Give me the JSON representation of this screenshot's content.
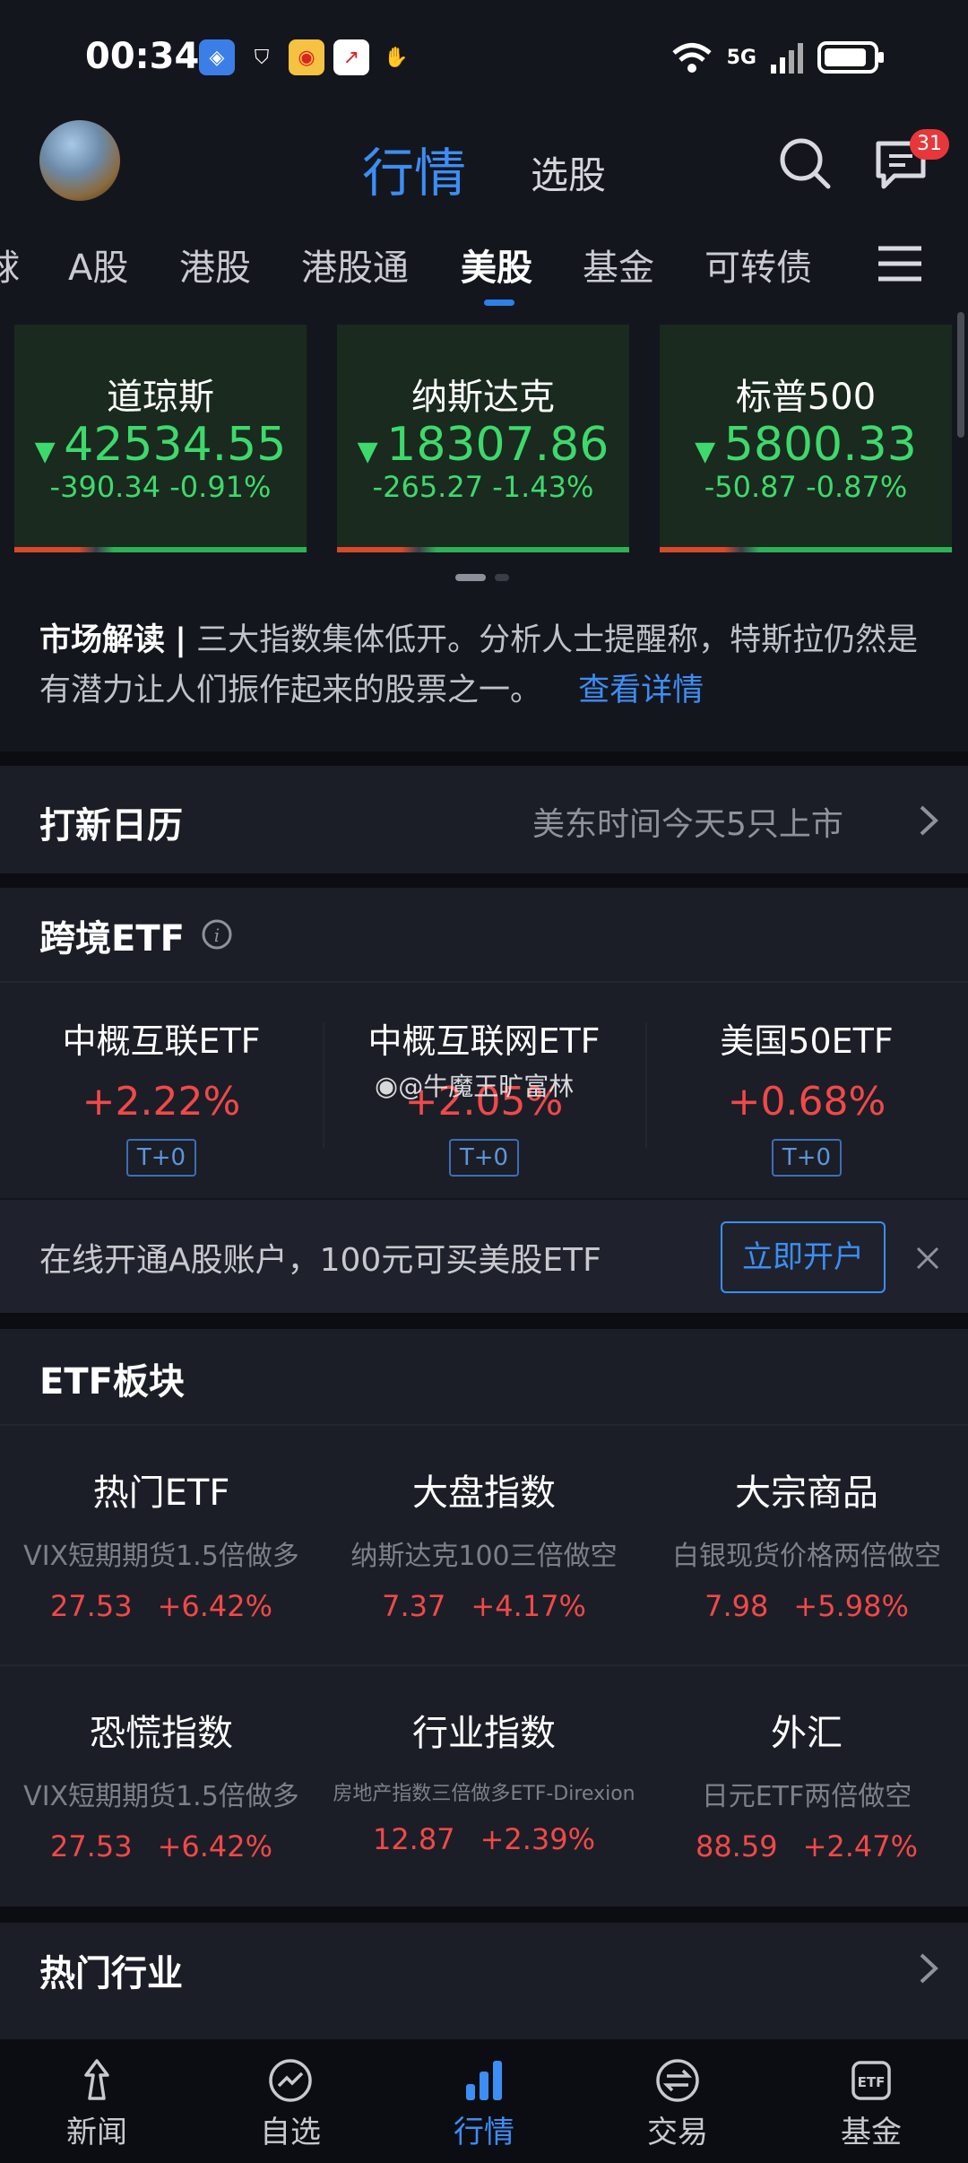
{
  "status_bar": {
    "time": "00:34",
    "network": "5G"
  },
  "header": {
    "title": "行情",
    "subtitle": "选股",
    "message_count": "31"
  },
  "tabs": [
    {
      "label": "球",
      "active": false
    },
    {
      "label": "A股",
      "active": false
    },
    {
      "label": "港股",
      "active": false
    },
    {
      "label": "港股通",
      "active": false
    },
    {
      "label": "美股",
      "active": true
    },
    {
      "label": "基金",
      "active": false
    },
    {
      "label": "可转债",
      "active": false
    }
  ],
  "indices": [
    {
      "name": "道琼斯",
      "value": "42534.55",
      "change": "-390.34  -0.91%"
    },
    {
      "name": "纳斯达克",
      "value": "18307.86",
      "change": "-265.27  -1.43%"
    },
    {
      "name": "标普500",
      "value": "5800.33",
      "change": "-50.87  -0.87%"
    }
  ],
  "commentary": {
    "label": "市场解读",
    "separator": "|",
    "text": "三大指数集体低开。分析人士提醒称，特斯拉仍然是有潜力让人们振作起来的股票之一。",
    "link": "查看详情"
  },
  "ipo": {
    "title": "打新日历",
    "info": "美东时间今天5只上市"
  },
  "cross_etf": {
    "title": "跨境ETF",
    "items": [
      {
        "name": "中概互联ETF",
        "pct": "+2.22%",
        "tag": "T+0"
      },
      {
        "name": "中概互联网ETF",
        "pct": "+2.05%",
        "tag": "T+0"
      },
      {
        "name": "美国50ETF",
        "pct": "+0.68%",
        "tag": "T+0"
      }
    ],
    "watermark": "@牛魔王旷富林"
  },
  "promo": {
    "text": "在线开通A股账户，100元可买美股ETF",
    "button": "立即开户"
  },
  "etf_sector": {
    "title": "ETF板块",
    "items": [
      {
        "title": "热门ETF",
        "desc": "VIX短期期货1.5倍做多",
        "price": "27.53",
        "pct": "+6.42%"
      },
      {
        "title": "大盘指数",
        "desc": "纳斯达克100三倍做空",
        "price": "7.37",
        "pct": "+4.17%"
      },
      {
        "title": "大宗商品",
        "desc": "白银现货价格两倍做空",
        "price": "7.98",
        "pct": "+5.98%"
      },
      {
        "title": "恐慌指数",
        "desc": "VIX短期期货1.5倍做多",
        "price": "27.53",
        "pct": "+6.42%"
      },
      {
        "title": "行业指数",
        "desc": "房地产指数三倍做多ETF-Direxion",
        "price": "12.87",
        "pct": "+2.39%"
      },
      {
        "title": "外汇",
        "desc": "日元ETF两倍做空",
        "price": "88.59",
        "pct": "+2.47%"
      }
    ]
  },
  "hot_industry": {
    "title": "热门行业"
  },
  "bottom_nav": [
    {
      "label": "新闻",
      "icon": "news-icon",
      "active": false
    },
    {
      "label": "自选",
      "icon": "watchlist-icon",
      "active": false
    },
    {
      "label": "行情",
      "icon": "market-icon",
      "active": true
    },
    {
      "label": "交易",
      "icon": "trade-icon",
      "active": false
    },
    {
      "label": "基金",
      "icon": "fund-icon",
      "active": false
    }
  ],
  "colors": {
    "accent": "#3c8ef5",
    "up": "#f24848",
    "down": "#3ed96c",
    "background": "#14161d"
  }
}
